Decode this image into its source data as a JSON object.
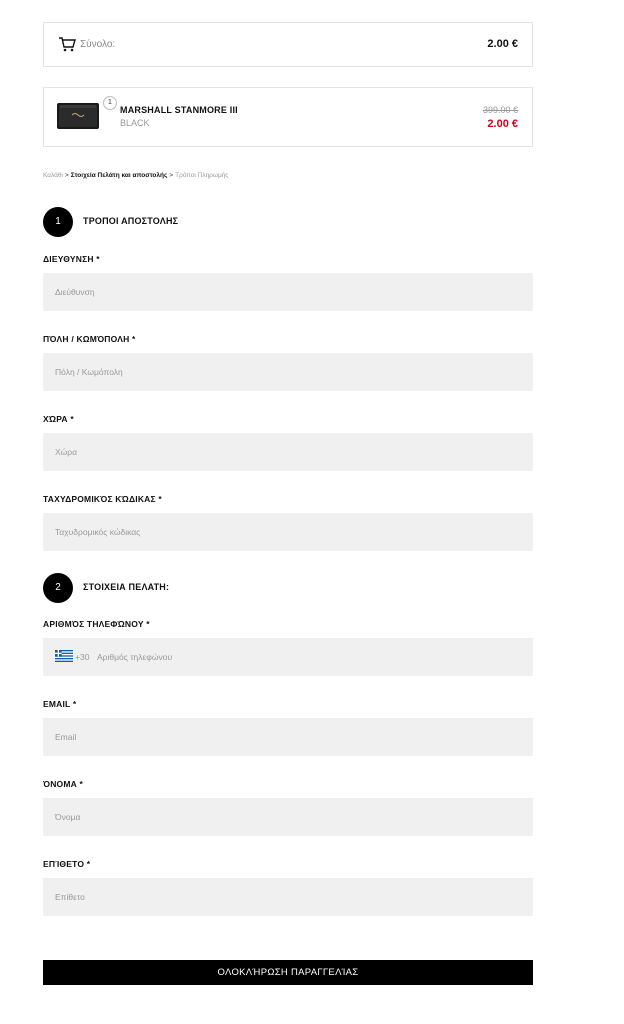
{
  "summary": {
    "label": "Σύνολο:",
    "total": "2.00 €",
    "cart_icon": "cart-icon"
  },
  "product": {
    "quantity": "1",
    "name": "MARSHALL STANMORE III",
    "variant": "BLACK",
    "old_price": "399.00 €",
    "new_price": "2.00 €",
    "price_color": "#d0021b"
  },
  "breadcrumb": {
    "items": [
      "Καλάθι",
      "Στοιχεία Πελάτη και αποστολής",
      "Τρόποι Πληρωμής"
    ],
    "separator": ">"
  },
  "sections": {
    "shipping": {
      "number": "1",
      "title": "ΤΡΟΠΟΙ ΑΠΟΣΤΟΛΗΣ"
    },
    "customer": {
      "number": "2",
      "title": "ΣΤΟΙΧΕΙΑ ΠΕΛΑΤΗ:"
    }
  },
  "fields": {
    "address": {
      "label": "ΔΙΕΥΘΥΝΣΗ *",
      "placeholder": "Διεύθυνση"
    },
    "city": {
      "label": "ΠΌΛΗ / ΚΩΜΌΠΟΛΗ *",
      "placeholder": "Πόλη / Κωμόπολη"
    },
    "country": {
      "label": "ΧΏΡΑ *",
      "placeholder": "Χώρα"
    },
    "postal": {
      "label": "ΤΑΧΥΔΡΟΜΙΚΌΣ ΚΏΔΙΚΑΣ *",
      "placeholder": "Ταχυδρομικός κώδικας"
    },
    "phone": {
      "label": "ΑΡΙΘΜΌΣ ΤΗΛΕΦΏΝΟΥ *",
      "dial_code": "+30",
      "placeholder": "Αριθμός τηλεφώνου",
      "flag_icon": "greece-flag-icon"
    },
    "email": {
      "label": "EMAIL *",
      "placeholder": "Email"
    },
    "first_name": {
      "label": "ΌΝΟΜΑ *",
      "placeholder": "Όνομα"
    },
    "last_name": {
      "label": "ΕΠΊΘΕΤΟ *",
      "placeholder": "Επίθετο"
    }
  },
  "submit_label": "ΟΛΟΚΛΉΡΩΣΗ ΠΑΡΑΓΓΕΛΊΑΣ"
}
